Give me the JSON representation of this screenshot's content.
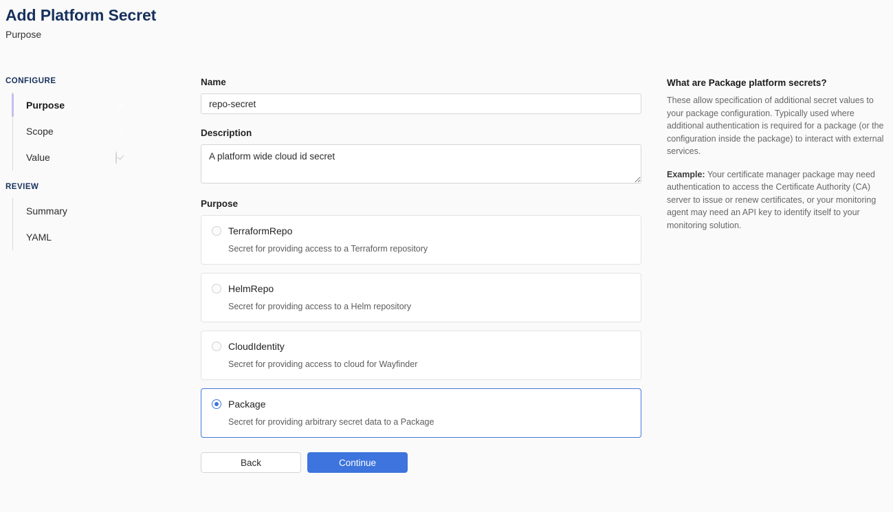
{
  "header": {
    "title": "Add Platform Secret",
    "subtitle": "Purpose"
  },
  "sidebar": {
    "configure_heading": "CONFIGURE",
    "review_heading": "REVIEW",
    "configure_items": [
      {
        "label": "Purpose",
        "status": "done",
        "active": true
      },
      {
        "label": "Scope",
        "status": "done",
        "active": false
      },
      {
        "label": "Value",
        "status": "todo",
        "active": false
      }
    ],
    "review_items": [
      {
        "label": "Summary"
      },
      {
        "label": "YAML"
      }
    ]
  },
  "form": {
    "name_label": "Name",
    "name_value": "repo-secret",
    "name_placeholder": "",
    "description_label": "Description",
    "description_value": "A platform wide cloud id secret",
    "description_placeholder": "",
    "purpose_label": "Purpose",
    "options": [
      {
        "title": "TerraformRepo",
        "description": "Secret for providing access to a Terraform repository",
        "selected": false
      },
      {
        "title": "HelmRepo",
        "description": "Secret for providing access to a Helm repository",
        "selected": false
      },
      {
        "title": "CloudIdentity",
        "description": "Secret for providing access to cloud for Wayfinder",
        "selected": false
      },
      {
        "title": "Package",
        "description": "Secret for providing arbitrary secret data to a Package",
        "selected": true
      }
    ],
    "back_label": "Back",
    "continue_label": "Continue"
  },
  "help": {
    "title": "What are Package platform secrets?",
    "paragraph1": "These allow specification of additional secret values to your package configuration. Typically used where additional authentication is required for a package (or the configuration inside the package) to interact with external services.",
    "example_label": "Example:",
    "paragraph2": " Your certificate manager package may need authentication to access the Certificate Authority (CA) server to issue or renew certificates, or your monitoring agent may need an API key to identify itself to your monitoring solution."
  },
  "colors": {
    "title_navy": "#16305c",
    "accent_blue": "#3d74dd",
    "active_bar_lavender": "#c2bff0",
    "check_done_navy": "#1c3262",
    "page_background": "#fafafa"
  }
}
